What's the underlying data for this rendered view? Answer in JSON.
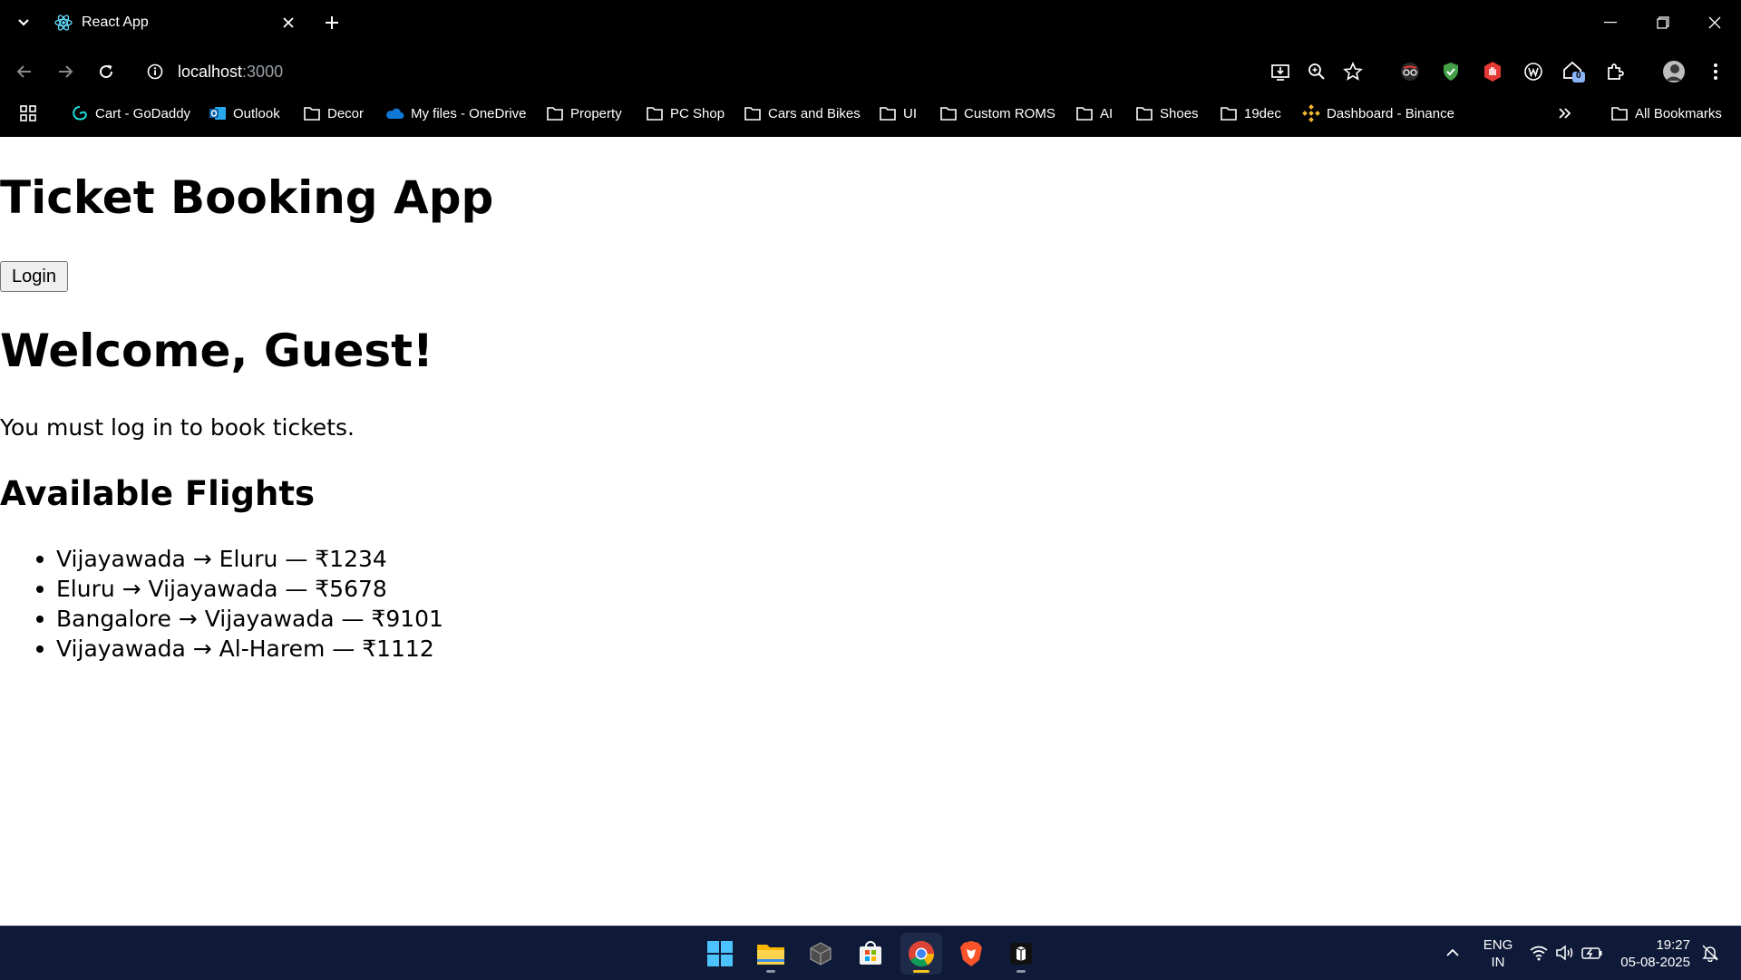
{
  "browser": {
    "tab_title": "React App",
    "url_host": "localhost",
    "url_port": ":3000",
    "bookmarks": [
      {
        "label": "Cart - GoDaddy",
        "icon": "godaddy-icon"
      },
      {
        "label": "Outlook",
        "icon": "outlook-icon"
      },
      {
        "label": "Decor",
        "icon": "folder-icon"
      },
      {
        "label": "My files - OneDrive",
        "icon": "onedrive-icon"
      },
      {
        "label": "Property",
        "icon": "folder-icon"
      },
      {
        "label": "PC Shop",
        "icon": "folder-icon"
      },
      {
        "label": "Cars and Bikes",
        "icon": "folder-icon"
      },
      {
        "label": "UI",
        "icon": "folder-icon"
      },
      {
        "label": "Custom ROMS",
        "icon": "folder-icon"
      },
      {
        "label": "AI",
        "icon": "folder-icon"
      },
      {
        "label": "Shoes",
        "icon": "folder-icon"
      },
      {
        "label": "19dec",
        "icon": "folder-icon"
      },
      {
        "label": "Dashboard - Binance",
        "icon": "binance-icon"
      }
    ],
    "all_bookmarks_label": "All Bookmarks",
    "extension_badge": "0"
  },
  "page": {
    "title": "Ticket Booking App",
    "login_label": "Login",
    "welcome": "Welcome, Guest!",
    "notice": "You must log in to book tickets.",
    "flights_heading": "Available Flights",
    "flights": [
      "Vijayawada → Eluru — ₹1234",
      "Eluru → Vijayawada — ₹5678",
      "Bangalore → Vijayawada — ₹9101",
      "Vijayawada → Al-Harem — ₹1112"
    ]
  },
  "taskbar": {
    "language_top": "ENG",
    "language_bottom": "IN",
    "time": "19:27",
    "date": "05-08-2025"
  },
  "colors": {
    "chrome_bg": "#000000",
    "taskbar_bg": "#0f1a38",
    "active_indicator": "#f6c21c"
  }
}
